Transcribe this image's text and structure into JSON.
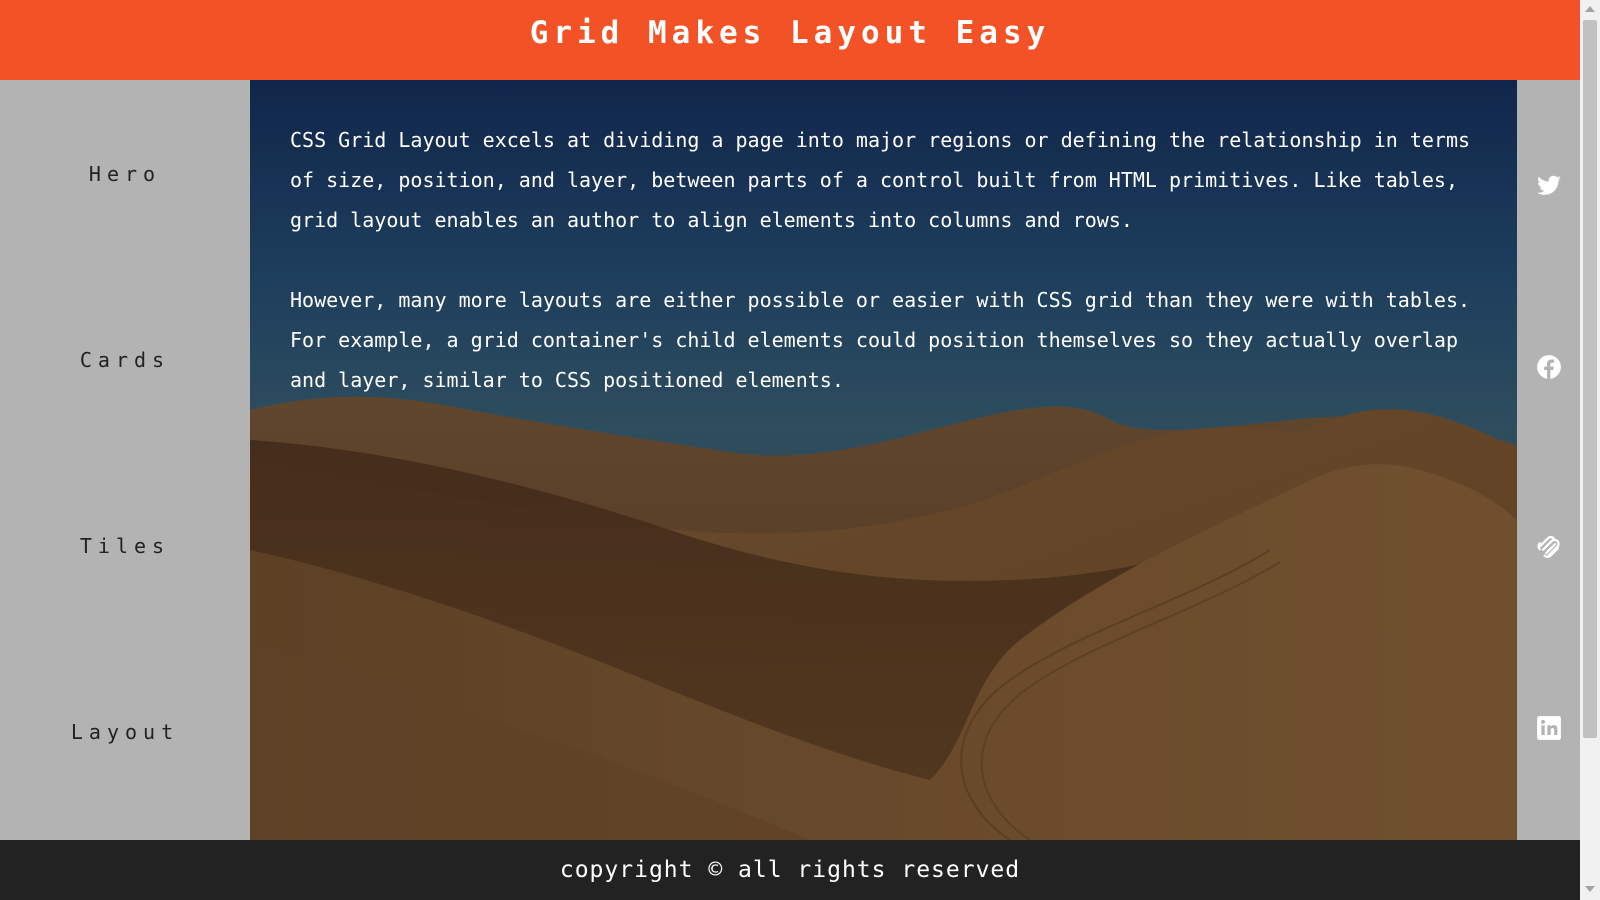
{
  "header": {
    "title": "Grid Makes Layout Easy"
  },
  "sidebar": {
    "items": [
      {
        "label": "Hero"
      },
      {
        "label": "Cards"
      },
      {
        "label": "Tiles"
      },
      {
        "label": "Layout"
      }
    ]
  },
  "hero": {
    "paragraphs": [
      "CSS Grid Layout excels at dividing a page into major regions or defining the relationship in terms of size, position, and layer, between parts of a control built from HTML primitives. Like tables, grid layout enables an author to align elements into columns and rows.",
      "However, many more layouts are either possible or easier with CSS grid than they were with tables. For example, a grid container's child elements could position themselves so they actually overlap and layer, similar to CSS positioned elements."
    ],
    "image": "desert-dunes"
  },
  "social": {
    "icons": [
      "twitter-icon",
      "facebook-icon",
      "squarespace-icon",
      "linkedin-icon"
    ]
  },
  "footer": {
    "text": "copyright © all rights reserved"
  },
  "colors": {
    "header_bg": "#f25225",
    "sidebar_bg": "#b3b3b3",
    "footer_bg": "#222222",
    "text_light": "#ffffff",
    "text_dark": "#222222"
  }
}
